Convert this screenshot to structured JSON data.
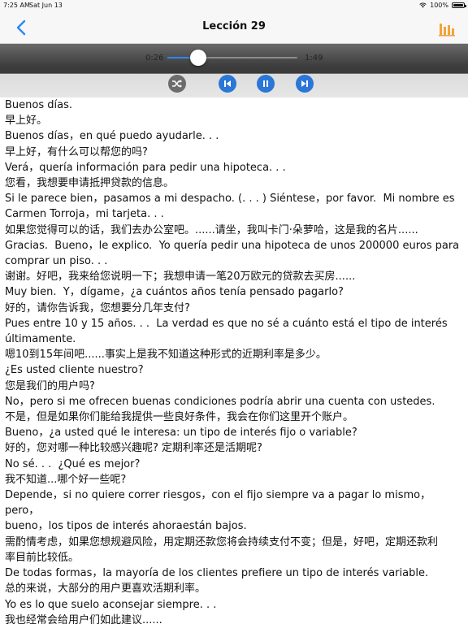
{
  "status_bar": {
    "time": "7:25 AM",
    "date": "Sat Jun 13",
    "battery": "100%"
  },
  "nav": {
    "title": "Lección 29"
  },
  "player": {
    "current_time": "0:26",
    "total_time": "1:49",
    "progress": 0.24
  },
  "colors": {
    "accent": "#2b77d8",
    "bar_chart_icon": "#f2a33a"
  },
  "icons": [
    "chevron-left-icon",
    "bar-chart-icon",
    "shuffle-icon",
    "skip-previous-icon",
    "pause-icon",
    "skip-next-icon",
    "wifi-icon",
    "battery-icon"
  ],
  "lines": [
    "Buenos días.",
    "早上好。",
    "Buenos días，en qué puedo ayudarle. . .",
    "早上好，有什么可以帮您的吗?",
    "Verá，quería información para pedir una hipoteca. . .",
    "您看，我想要申请抵押贷款的信息。",
    "Si le parece bien，pasamos a mi despacho. (. . . ) Siéntese，por favor.  Mi nombre es",
    "Carmen Torroja，mi tarjeta. . .",
    "如果您觉得可以的话，我们去办公室吧。......请坐，我叫卡门·朵萝哈，这是我的名片......",
    "Gracias.  Bueno，le explico.  Yo quería pedir una hipoteca de unos 200000 euros para",
    "comprar un piso. . .",
    "谢谢。好吧，我来给您说明一下；我想申请一笔20万欧元的贷款去买房......",
    "Muy bien.  Y，dígame，¿a cuántos años tenía pensado pagarlo?",
    "好的，请你告诉我，您想要分几年支付?",
    "Pues entre 10 y 15 años. . .  La verdad es que no sé a cuánto está el tipo de interés",
    "últimamente.",
    "嗯10到15年间吧......事实上是我不知道这种形式的近期利率是多少。",
    "¿Es usted cliente nuestro?",
    "您是我们的用户吗?",
    "No，pero si me ofrecen buenas condiciones podría abrir una cuenta con ustedes.",
    "不是，但是如果你们能给我提供一些良好条件，我会在你们这里开个账户。",
    "Bueno，¿a usted qué le interesa: un tipo de interés fijo o variable?",
    "好的，您对哪一种比较感兴趣呢? 定期利率还是活期呢?",
    "No sé. . .  ¿Qué es mejor?",
    "我不知道...哪个好一些呢?",
    "Depende，si no quiere correr riesgos，con el fijo siempre va a pagar lo mismo，pero，",
    "bueno，los tipos de interés ahoraestán bajos.",
    "需酌情考虑，如果您想规避风险，用定期还款您将会持续支付不变；但是，好吧，定期还款利",
    "率目前比较低。",
    "De todas formas，la mayoría de los clientes prefiere un tipo de interés variable.",
    "总的来说，大部分的用户更喜欢活期利率。",
    "Yo es lo que suelo aconsejar siempre. . .",
    "我也经常会给用户们如此建议......"
  ]
}
